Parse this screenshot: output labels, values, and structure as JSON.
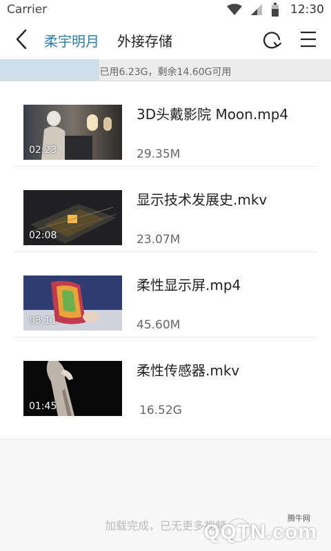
{
  "status_bar": {
    "carrier": "Carrier",
    "time": "12:30"
  },
  "nav": {
    "tabs": [
      {
        "label": "柔宇明月",
        "active": true
      },
      {
        "label": "外接存储",
        "active": false
      }
    ]
  },
  "storage": {
    "text": "已用6.23G，剩余14.60G可用",
    "used_fraction": 0.3
  },
  "files": [
    {
      "name": "3D头戴影院 Moon.mp4",
      "size": "29.35M",
      "duration": "02:23",
      "icon": "video-thumbnail"
    },
    {
      "name": "显示技术发展史.mkv",
      "size": "23.07M",
      "duration": "02:08",
      "icon": "video-thumbnail"
    },
    {
      "name": "柔性显示屏.mp4",
      "size": "45.60M",
      "duration": "03:11",
      "icon": "video-thumbnail"
    },
    {
      "name": "柔性传感器.mkv",
      "size": "16.52G",
      "duration": "01:45",
      "icon": "video-thumbnail"
    }
  ],
  "footer": {
    "text": "加载完成，已无更多视频"
  },
  "watermark": {
    "site": "腾牛网",
    "text": "QQTN.com"
  },
  "colors": {
    "accent": "#2c7fa9",
    "storage_fill": "#cfe0ea"
  }
}
